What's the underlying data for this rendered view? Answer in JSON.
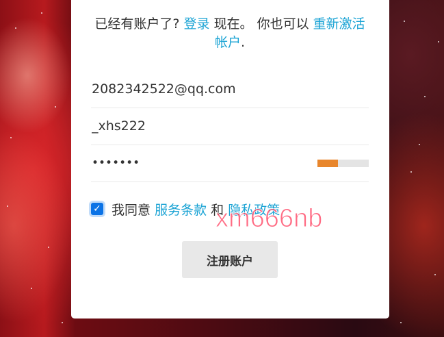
{
  "intro": {
    "text_before": "已经有账户了?",
    "login_link": "登录",
    "text_middle": "现在。 你也可以",
    "reactivate_link": "重新激活帐户",
    "text_end": "."
  },
  "form": {
    "email_value": "2082342522@qq.com",
    "username_value": "_xhs222",
    "password_value": "•••••••",
    "password_strength": 0.4,
    "password_strength_color": "#e8862c"
  },
  "agreement": {
    "checked": true,
    "text_before": "我同意",
    "terms_link": "服务条款",
    "text_middle": "和",
    "privacy_link": "隐私政策"
  },
  "submit": {
    "label": "注册账户"
  },
  "watermark": {
    "text": "xm666nb"
  },
  "colors": {
    "link": "#1aa3d4",
    "checkbox": "#0b73e6",
    "button_bg": "#e8e8e8"
  }
}
